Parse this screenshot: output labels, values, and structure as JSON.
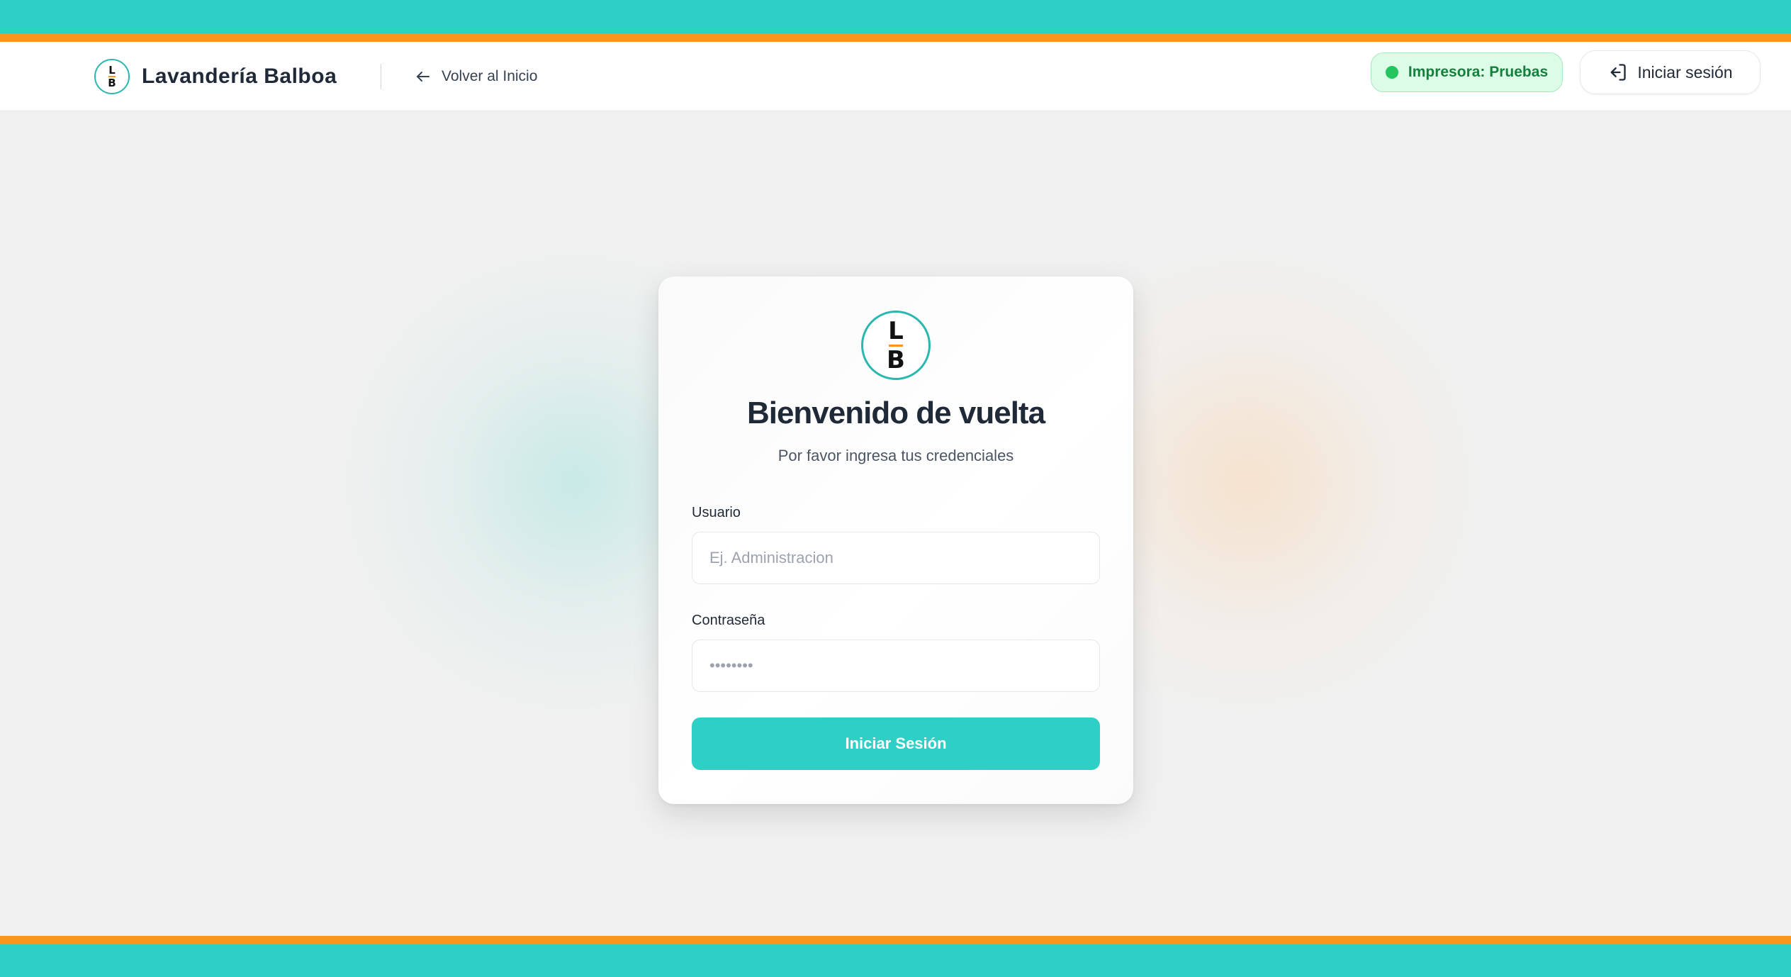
{
  "colors": {
    "teal": "#2ecfc5",
    "orange": "#f7951d",
    "badge_bg": "#dcfce7",
    "badge_text": "#15803d",
    "background": "#f0f0f0"
  },
  "header": {
    "logo_letters": {
      "top": "L",
      "bottom": "B"
    },
    "brand_name": "Lavandería Balboa",
    "back_link": {
      "icon": "arrow-left-icon",
      "label": "Volver al Inicio"
    },
    "printer_status": {
      "icon": "status-dot",
      "label": "Impresora: Pruebas"
    },
    "login_button": {
      "icon": "login-icon",
      "label": "Iniciar sesión"
    }
  },
  "login_card": {
    "logo_letters": {
      "top": "L",
      "bottom": "B"
    },
    "title": "Bienvenido de vuelta",
    "subtitle": "Por favor ingresa tus credenciales",
    "username": {
      "label": "Usuario",
      "placeholder": "Ej. Administracion",
      "value": ""
    },
    "password": {
      "label": "Contraseña",
      "placeholder": "••••••••",
      "value": ""
    },
    "submit_label": "Iniciar Sesión"
  }
}
